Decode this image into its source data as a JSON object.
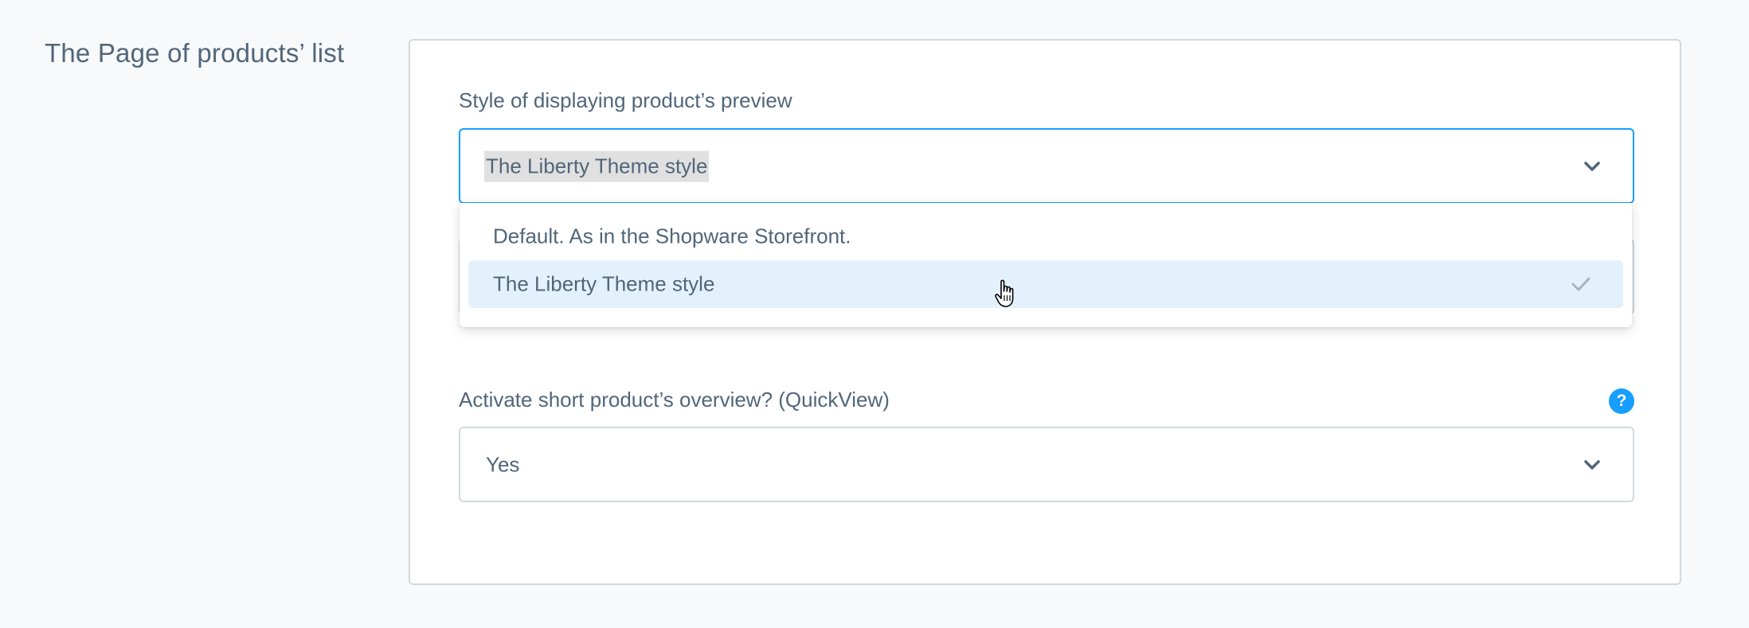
{
  "section": {
    "title": "The Page of products’ list"
  },
  "fields": {
    "preview_style": {
      "label": "Style of displaying product’s preview",
      "value": "The Liberty Theme style",
      "options": [
        {
          "label": "Default. As in the Shopware Storefront.",
          "selected": false
        },
        {
          "label": "The Liberty Theme style",
          "selected": true
        }
      ],
      "open": true
    },
    "quickview": {
      "label": "Activate short product’s overview? (QuickView)",
      "value": "Yes",
      "help_symbol": "?"
    }
  },
  "icons": {
    "chevron": "chevron-down-icon",
    "check": "check-icon",
    "help": "help-icon",
    "cursor": "hand-pointer-icon"
  },
  "colors": {
    "accent": "#189eff",
    "text": "#52667a",
    "border": "#d1d9e0",
    "selected_option_bg": "#e3f1fc",
    "page_bg": "#f7f9fb"
  }
}
